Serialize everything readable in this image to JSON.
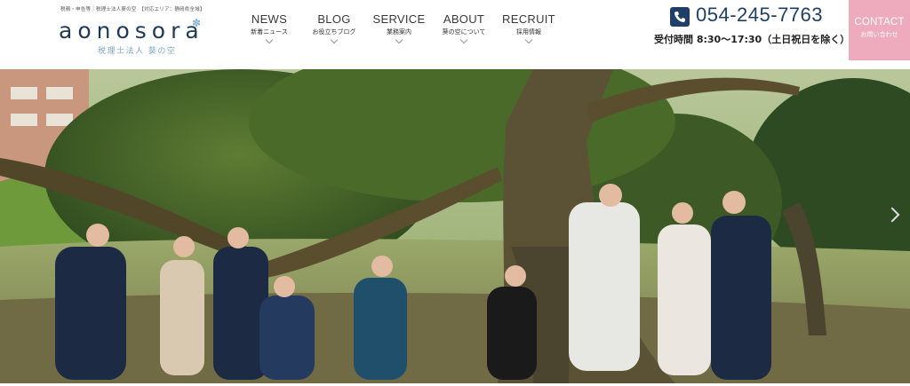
{
  "header": {
    "tagline": "税務・申告等｜税理士法人葵の空　【対応エリア：静岡県全域】",
    "logo_text": "aonosora",
    "logo_sub": "税理士法人 葵の空",
    "nav": [
      {
        "en": "NEWS",
        "jp": "新着ニュース"
      },
      {
        "en": "BLOG",
        "jp": "お役立ちブログ"
      },
      {
        "en": "SERVICE",
        "jp": "業務案内"
      },
      {
        "en": "ABOUT",
        "jp": "葵の空について"
      },
      {
        "en": "RECRUIT",
        "jp": "採用情報"
      }
    ],
    "phone": "054-245-7763",
    "hours": "受付時間 8:30～17:30（土日祝日を除く）",
    "contact_en": "CONTACT",
    "contact_jp": "お問い合わせ"
  },
  "colors": {
    "brand_navy": "#1f3f66",
    "contact_pink": "#eeabbd",
    "logo_blue": "#7fa8c8"
  },
  "icons": {
    "phone": "phone-icon",
    "slider_next": "chevron-right-icon"
  }
}
